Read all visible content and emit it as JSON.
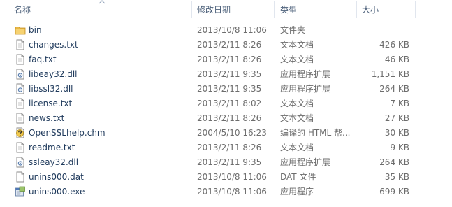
{
  "header": {
    "name_label": "名称",
    "date_label": "修改日期",
    "type_label": "类型",
    "size_label": "大小"
  },
  "files": [
    {
      "icon": "folder-icon",
      "name": "bin",
      "date": "2013/10/8 11:06",
      "type": "文件夹",
      "size": ""
    },
    {
      "icon": "text-file-icon",
      "name": "changes.txt",
      "date": "2013/2/11 8:26",
      "type": "文本文档",
      "size": "426 KB"
    },
    {
      "icon": "text-file-icon",
      "name": "faq.txt",
      "date": "2013/2/11 8:26",
      "type": "文本文档",
      "size": "46 KB"
    },
    {
      "icon": "dll-file-icon",
      "name": "libeay32.dll",
      "date": "2013/2/11 9:35",
      "type": "应用程序扩展",
      "size": "1,151 KB"
    },
    {
      "icon": "dll-file-icon",
      "name": "libssl32.dll",
      "date": "2013/2/11 9:35",
      "type": "应用程序扩展",
      "size": "264 KB"
    },
    {
      "icon": "text-file-icon",
      "name": "license.txt",
      "date": "2013/2/11 8:02",
      "type": "文本文档",
      "size": "7 KB"
    },
    {
      "icon": "text-file-icon",
      "name": "news.txt",
      "date": "2013/2/11 8:26",
      "type": "文本文档",
      "size": "27 KB"
    },
    {
      "icon": "help-file-icon",
      "name": "OpenSSLhelp.chm",
      "date": "2004/5/10 16:23",
      "type": "编译的 HTML 帮...",
      "size": "30 KB"
    },
    {
      "icon": "text-file-icon",
      "name": "readme.txt",
      "date": "2013/2/11 8:26",
      "type": "文本文档",
      "size": "9 KB"
    },
    {
      "icon": "dll-file-icon",
      "name": "ssleay32.dll",
      "date": "2013/2/11 9:35",
      "type": "应用程序扩展",
      "size": "264 KB"
    },
    {
      "icon": "blank-file-icon",
      "name": "unins000.dat",
      "date": "2013/10/8 11:06",
      "type": "DAT 文件",
      "size": "35 KB"
    },
    {
      "icon": "exe-file-icon",
      "name": "unins000.exe",
      "date": "2013/10/8 11:06",
      "type": "应用程序",
      "size": "699 KB"
    }
  ]
}
